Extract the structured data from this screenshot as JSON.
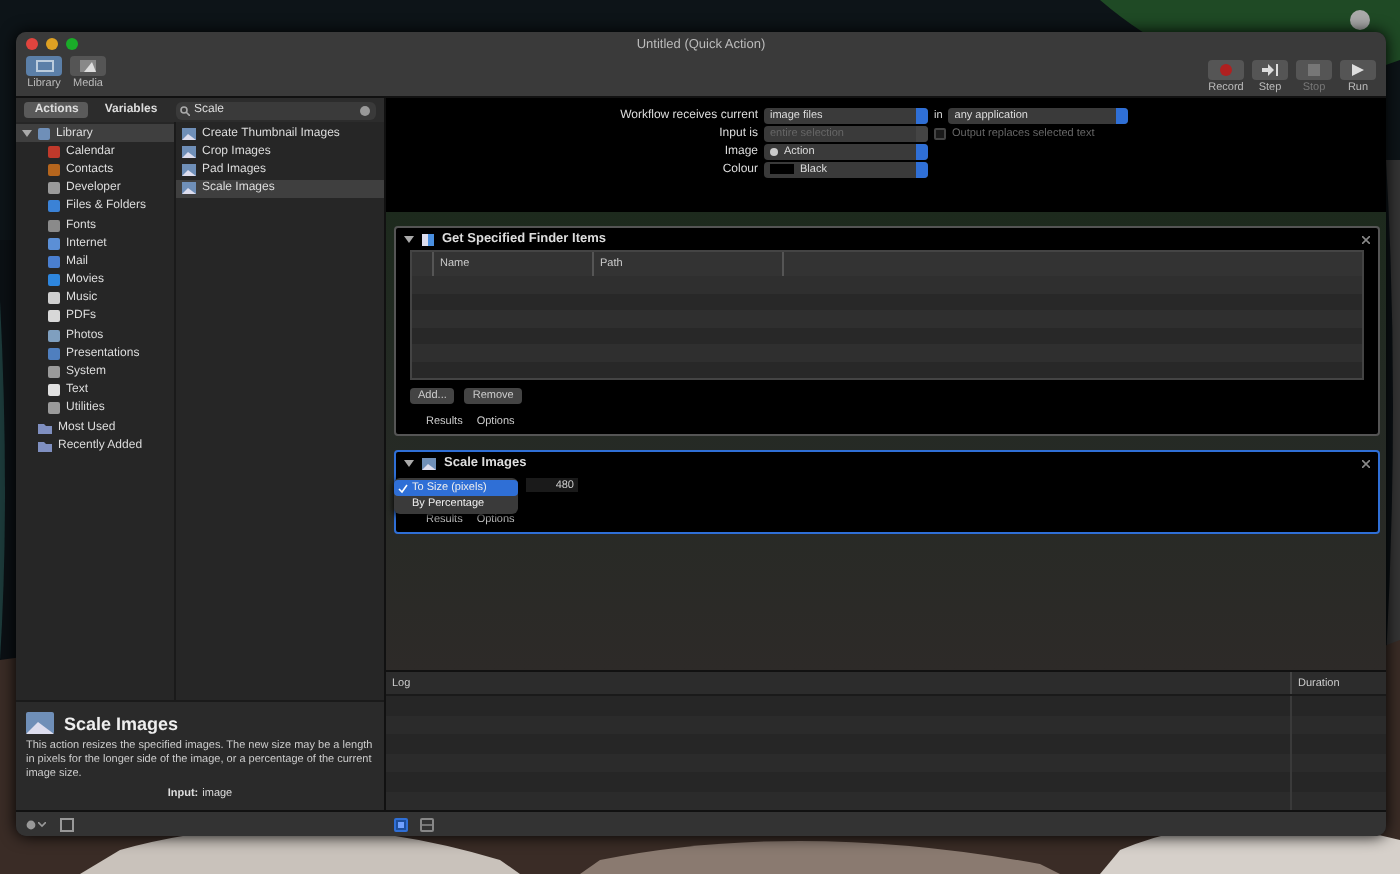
{
  "window": {
    "title": "Untitled (Quick Action)"
  },
  "toolbar": {
    "left": [
      {
        "label": "Library",
        "kind": "library",
        "selected": true
      },
      {
        "label": "Media",
        "kind": "media",
        "selected": false
      }
    ],
    "right": [
      {
        "label": "Record",
        "kind": "record",
        "disabled": false
      },
      {
        "label": "Step",
        "kind": "step",
        "disabled": false
      },
      {
        "label": "Stop",
        "kind": "stop",
        "disabled": true
      },
      {
        "label": "Run",
        "kind": "run",
        "disabled": false
      }
    ]
  },
  "library": {
    "tabs": [
      {
        "label": "Actions",
        "selected": true
      },
      {
        "label": "Variables",
        "selected": false
      }
    ],
    "search": {
      "value": "Scale"
    },
    "categories": [
      {
        "label": "Library",
        "expanded": true,
        "selected": true,
        "children": [
          {
            "label": "Calendar",
            "color": "#c0392b"
          },
          {
            "label": "Contacts",
            "color": "#b5651d"
          },
          {
            "label": "Developer",
            "color": "#9a9a9a"
          },
          {
            "label": "Files & Folders",
            "color": "#3b82d6"
          },
          {
            "label": "Fonts",
            "color": "#8a8a8a"
          },
          {
            "label": "Internet",
            "color": "#5b8fd6"
          },
          {
            "label": "Mail",
            "color": "#4a7fd0"
          },
          {
            "label": "Movies",
            "color": "#2e86de"
          },
          {
            "label": "Music",
            "color": "#d0d0d0"
          },
          {
            "label": "PDFs",
            "color": "#d8d8d8"
          },
          {
            "label": "Photos",
            "color": "#7f9fbf"
          },
          {
            "label": "Presentations",
            "color": "#4f7fbf"
          },
          {
            "label": "System",
            "color": "#9a9a9a"
          },
          {
            "label": "Text",
            "color": "#e0e0e0"
          },
          {
            "label": "Utilities",
            "color": "#9a9a9a"
          }
        ]
      },
      {
        "label": "Most Used",
        "selected": false
      },
      {
        "label": "Recently Added",
        "selected": false
      }
    ],
    "actions": [
      {
        "label": "Create Thumbnail Images",
        "selected": false
      },
      {
        "label": "Crop Images",
        "selected": false
      },
      {
        "label": "Pad Images",
        "selected": false
      },
      {
        "label": "Scale Images",
        "selected": true
      }
    ],
    "description": {
      "title": "Scale Images",
      "text": "This action resizes the specified images. The new size may be a length in pixels for the longer side of the image, or a percentage of the current image size.",
      "input_label": "Input:",
      "input_value": "image"
    }
  },
  "workflow": {
    "settings": [
      {
        "kind": "plain",
        "label": "Workflow receives current",
        "popup": "image files",
        "disabled": false,
        "in_label": "in",
        "in_popup": "any application"
      },
      {
        "kind": "plain",
        "label": "Input is",
        "popup": "entire selection",
        "disabled": true,
        "checkbox": {
          "label": "Output replaces selected text",
          "checked": false,
          "disabled": true
        }
      },
      {
        "kind": "icon",
        "label": "Image",
        "popup": "Action",
        "disabled": false
      },
      {
        "kind": "swatch",
        "label": "Colour",
        "popup": "Black",
        "disabled": false
      }
    ],
    "actions": [
      {
        "title": "Get Specified Finder Items",
        "kind": "finder",
        "selected": false,
        "expanded": true,
        "columns": [
          "Name",
          "Path"
        ],
        "buttons": [
          "Add...",
          "Remove"
        ],
        "tabs": [
          "Results",
          "Options"
        ]
      },
      {
        "title": "Scale Images",
        "kind": "scale",
        "selected": true,
        "expanded": true,
        "value": "480",
        "tabs": [
          "Results",
          "Options"
        ],
        "menu": [
          {
            "label": "To Size (pixels)",
            "selected": true
          },
          {
            "label": "By Percentage",
            "selected": false
          }
        ]
      }
    ]
  },
  "log": {
    "columns": [
      "Log",
      "Duration"
    ],
    "views": [
      {
        "kind": "single",
        "selected": true
      },
      {
        "kind": "split",
        "selected": false
      }
    ]
  }
}
